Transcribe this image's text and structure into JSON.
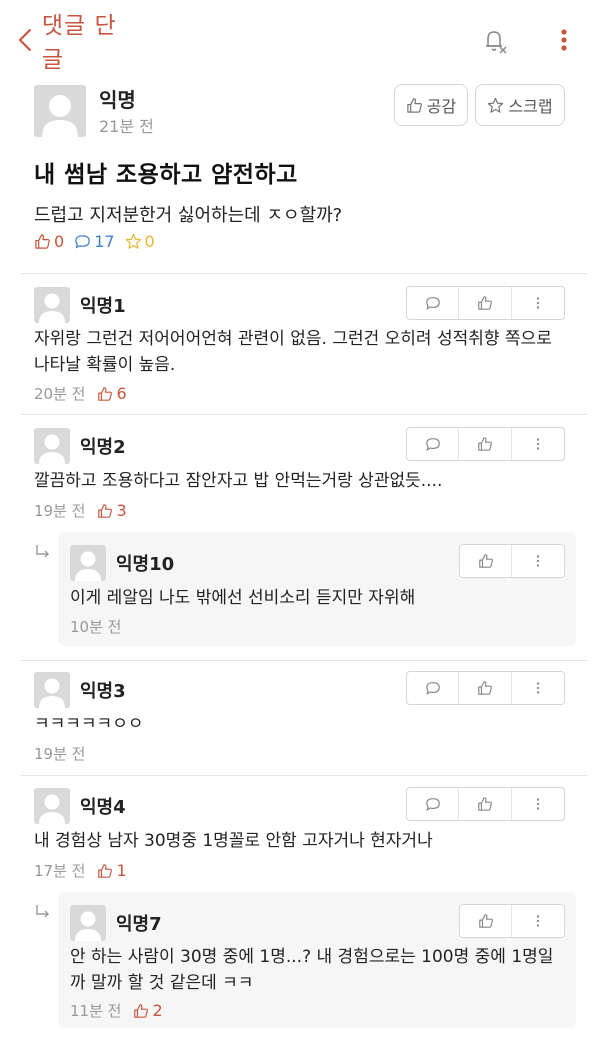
{
  "header": {
    "title": "댓글 단 글"
  },
  "post": {
    "author": "익명",
    "time": "21분 전",
    "like_label": "공감",
    "scrap_label": "스크랩",
    "title": "내 썸남 조용하고 얌전하고",
    "body": "드럽고 지저분한거 싫어하는데 ㅈㅇ할까?",
    "likes": "0",
    "comments": "17",
    "scraps": "0"
  },
  "comments": [
    {
      "author": "익명1",
      "text": "자위랑 그런건 저어어어언혀 관련이 없음. 그런건 오히려 성적취향 쪽으로 나타날 확률이 높음.",
      "time": "20분 전",
      "likes": "6"
    },
    {
      "author": "익명2",
      "text": "깔끔하고 조용하다고 잠안자고 밥 안먹는거랑 상관없듯....",
      "time": "19분 전",
      "likes": "3"
    },
    {
      "author": "익명10",
      "text": "이게 레알임 나도 밖에선 선비소리 듣지만 자위해",
      "time": "10분 전",
      "likes": ""
    },
    {
      "author": "익명3",
      "text": "ㅋㅋㅋㅋㅋㅇㅇ",
      "time": "19분 전",
      "likes": ""
    },
    {
      "author": "익명4",
      "text": "내 경험상 남자 30명중 1명꼴로 안함 고자거나 현자거나",
      "time": "17분 전",
      "likes": "1"
    },
    {
      "author": "익명7",
      "text": "안 하는 사람이 30명 중에 1명...? 내 경험으로는 100명 중에 1명일까 말까 할 것 같은데 ㅋㅋ",
      "time": "11분 전",
      "likes": "2"
    }
  ],
  "colors": {
    "accent": "#c8553d",
    "comment_icon": "#3b82c4",
    "scrap_icon": "#e8b530",
    "muted": "#999999"
  }
}
